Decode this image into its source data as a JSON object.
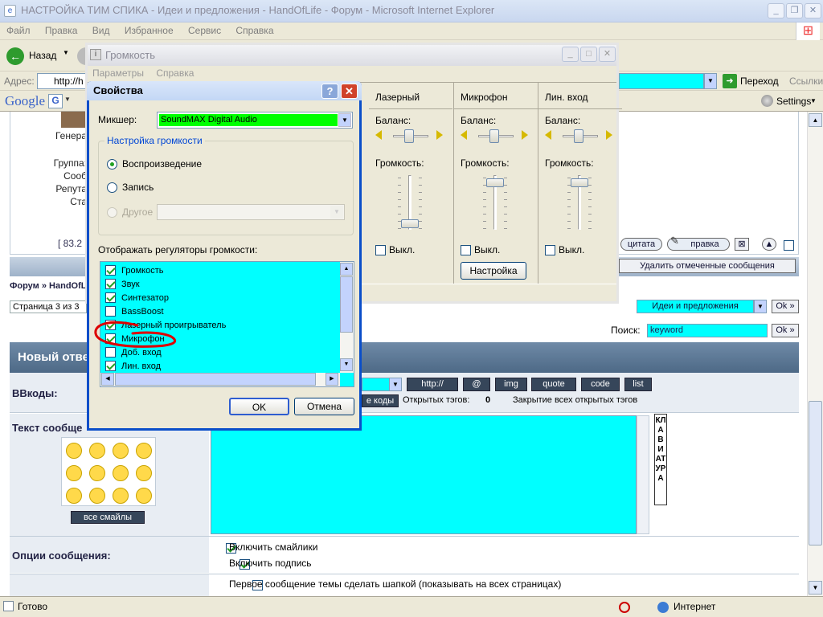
{
  "browser": {
    "title": "НАСТРОЙКА ТИМ СПИКА - Идеи и предложения - HandOfLife - Форум - Microsoft Internet Explorer",
    "menu": [
      "Файл",
      "Правка",
      "Вид",
      "Избранное",
      "Сервис",
      "Справка"
    ],
    "back_label": "Назад",
    "address_label": "Адрес:",
    "address_value": "http://h",
    "go_label": "Переход",
    "links_label": "Ссылки",
    "google_label": "Google",
    "settings_label": "Settings",
    "status_text": "Готово",
    "zone_text": "Интернет"
  },
  "forum": {
    "profile_lines": [
      "Генера",
      "Группа:",
      "Сооб",
      "Репута",
      "Ста"
    ],
    "ip_text": "[ 83.2",
    "quote_btn": "цитата",
    "edit_btn": "правка",
    "delete_selected_btn": "Удалить отмеченные сообщения",
    "breadcrumb_home": "Форум",
    "breadcrumb_sep": "»",
    "breadcrumb_forum": "HandOfLi",
    "page_text": "Страница 3 из 3",
    "jump_select": "Идеи и предложения",
    "ok_label": "Ok »",
    "search_label": "Поиск:",
    "search_value": "keyword",
    "new_reply_header": "Новый отве",
    "bbcodes_label": "BBкоды:",
    "bbcode_buttons": [
      "http://",
      "@",
      "img",
      "quote",
      "code",
      "list"
    ],
    "close_codes_btn": "е коды",
    "open_tags_label": "Открытых тэгов:",
    "open_tags_count": "0",
    "close_all_tags": "Закрытие всех открытых тэгов",
    "message_text_label": "Текст сообще",
    "keyboard_label": "КЛАВИАТУРА",
    "all_smilies_btn": "все смайлы",
    "options_label": "Опции сообщения:",
    "option_smilies": "Включить смайлики",
    "option_signature": "Включить подпись",
    "option_header": "Первое сообщение темы сделать шапкой (показывать на всех страницах)"
  },
  "volume_window": {
    "title": "Громкость",
    "menu": [
      "Параметры",
      "Справка"
    ],
    "channels": [
      {
        "name": "Лазерный",
        "balance_label": "Баланс:",
        "volume_label": "Громкость:",
        "mute_label": "Выкл.",
        "volume_level": 0.1
      },
      {
        "name": "Микрофон",
        "balance_label": "Баланс:",
        "volume_label": "Громкость:",
        "mute_label": "Выкл.",
        "volume_level": 0.9,
        "settings_btn": "Настройка"
      },
      {
        "name": "Лин. вход",
        "balance_label": "Баланс:",
        "volume_label": "Громкость:",
        "mute_label": "Выкл.",
        "volume_level": 0.9
      }
    ]
  },
  "properties_dialog": {
    "title": "Свойства",
    "mixer_label": "Микшер:",
    "mixer_value": "SoundMAX Digital Audio",
    "group_label": "Настройка громкости",
    "radio_playback": "Воспроизведение",
    "radio_record": "Запись",
    "radio_other": "Другое",
    "list_label": "Отображать регуляторы громкости:",
    "items": [
      {
        "label": "Громкость",
        "checked": true
      },
      {
        "label": "Звук",
        "checked": true
      },
      {
        "label": "Синтезатор",
        "checked": true
      },
      {
        "label": "BassBoost",
        "checked": false
      },
      {
        "label": "Лазерный проигрыватель",
        "checked": true
      },
      {
        "label": "Микрофон",
        "checked": true
      },
      {
        "label": "Доб. вход",
        "checked": false
      },
      {
        "label": "Лин. вход",
        "checked": true
      }
    ],
    "ok_label": "OK",
    "cancel_label": "Отмена"
  },
  "colors": {
    "highlight": "#00ffff",
    "mixer": "#00ff00",
    "xp_blue": "#0a4ec9",
    "annotation": "#dd0000"
  }
}
